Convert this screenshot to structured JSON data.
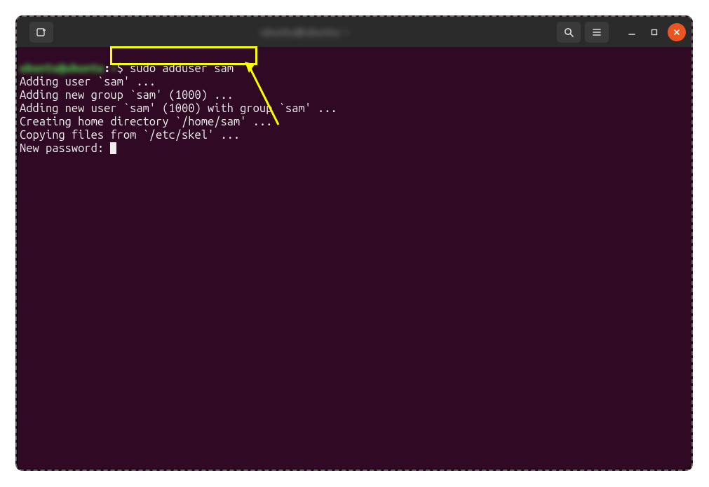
{
  "titlebar": {
    "title": "ubuntu@ubuntu: ~",
    "new_tab_tooltip": "New Tab",
    "search_tooltip": "Search",
    "menu_tooltip": "Menu",
    "minimize_tooltip": "Minimize",
    "maximize_tooltip": "Maximize",
    "close_tooltip": "Close"
  },
  "terminal": {
    "prompt_user": "ubuntu@ubuntu",
    "prompt_sep": ":",
    "prompt_path": "~",
    "prompt_symbol": "$ ",
    "command": "sudo adduser sam",
    "lines": {
      "l1": "Adding user `sam' ...",
      "l2": "Adding new group `sam' (1000) ...",
      "l3": "Adding new user `sam' (1000) with group `sam' ...",
      "l4": "Creating home directory `/home/sam' ...",
      "l5": "Copying files from `/etc/skel' ...",
      "l6": "New password: "
    }
  },
  "annotation": {
    "highlight_target": "command-input",
    "arrow_target": "command-input"
  }
}
